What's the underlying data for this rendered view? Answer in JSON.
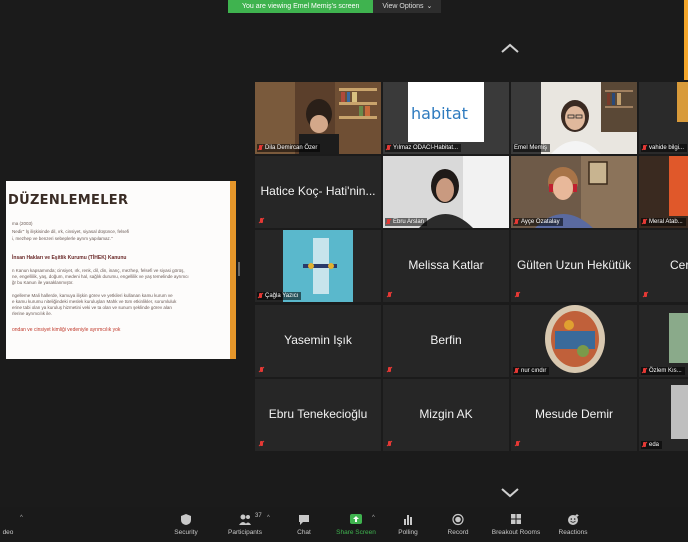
{
  "banner": {
    "viewing_text": "You are viewing Emel Memiş's screen",
    "options_label": "View Options",
    "options_caret": "⌄"
  },
  "slide": {
    "title": "DÜZENLEMELER",
    "lines": [
      "ma (2003)",
      "Nedir\" İş ilişkisinde dil, ırk, cinsiyet, siyasal          düşünce, felsefi",
      "i, mezhep ve benzeri sebeplerle ayrım yapılamaz.\""
    ],
    "subheading": "İnsan Hakları ve Eşitlik Kurumu (TİHEK) Kanunu",
    "body_lines": [
      "n Kanun kapsamında; cinsiyet, ırk, renk, dil, din, inanç, mezhep, felsefi ve siyasi görüş,",
      "ne, engellilik, yaş, doğum, medeni hal, sağlık durumu, engellilik ve yaş temelinde ayrımcı",
      "ğr bu Kanun ile yasaklanmıştır.",
      "ngelleme Mali hallerde, kamuya ilişkin görev ve yetkileri kullanan kamu kurum ve",
      "e kamu kurumu niteliğindeki meslek kuruluşları Mahk ve tüm etkinlikler, sorumluluk",
      "erine tabi olan ya kuruluş hizmetini veki ve ta olan ve sunum şeklinde görev alan",
      "rlerine ayrımcılık ile."
    ],
    "red_line": "ondan ve cinsiyet kimliği vedeniyle ayrımcılık yok"
  },
  "tiles": [
    {
      "label": "Dila Demircan Özer"
    },
    {
      "label": "Yılmaz ODACI-Habitat...",
      "logo_text": "habitat"
    },
    {
      "label": "Emel Memiş"
    },
    {
      "label": "vahide bilgi..."
    },
    {
      "label": "Hatice Koç- Hati'nin..."
    },
    {
      "label": "Ebru Arslan"
    },
    {
      "label": "Ayçe Ozatalay"
    },
    {
      "label": "Meral Atab..."
    },
    {
      "label": "Çağla Yazıcı"
    },
    {
      "label": "Melissa Katlar"
    },
    {
      "label": "Gülten Uzun Hekütük"
    },
    {
      "label": "Cer"
    },
    {
      "label": "Yasemin Işık"
    },
    {
      "label": "Berfin"
    },
    {
      "label": "nur cındır"
    },
    {
      "label": "Özlem Kıs..."
    },
    {
      "label": "Ebru Tenekecioğlu"
    },
    {
      "label": "Mizgin AK"
    },
    {
      "label": "Mesude Demir"
    },
    {
      "label": "eda"
    }
  ],
  "toolbar": {
    "video_label": "deo",
    "security": "Security",
    "participants": "Participants",
    "participants_count": "37",
    "chat": "Chat",
    "share_screen": "Share Screen",
    "polling": "Polling",
    "record": "Record",
    "breakout": "Breakout Rooms",
    "reactions": "Reactions",
    "caret": "^"
  },
  "colors": {
    "accent_green": "#3fb34f",
    "active_speaker": "#a6d73b",
    "muted_red": "#e53935",
    "slide_orange": "#e5962a"
  }
}
